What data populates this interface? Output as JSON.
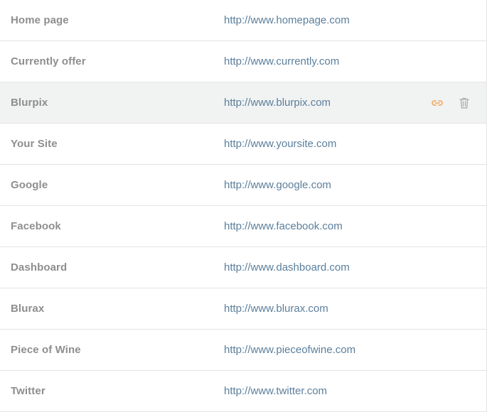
{
  "links": [
    {
      "name": "Home page",
      "url": "http://www.homepage.com"
    },
    {
      "name": "Currently offer",
      "url": "http://www.currently.com"
    },
    {
      "name": "Blurpix",
      "url": "http://www.blurpix.com",
      "highlighted": true
    },
    {
      "name": "Your Site",
      "url": "http://www.yoursite.com"
    },
    {
      "name": "Google",
      "url": "http://www.google.com"
    },
    {
      "name": "Facebook",
      "url": "http://www.facebook.com"
    },
    {
      "name": "Dashboard",
      "url": "http://www.dashboard.com"
    },
    {
      "name": "Blurax",
      "url": "http://www.blurax.com"
    },
    {
      "name": "Piece of Wine",
      "url": "http://www.pieceofwine.com"
    },
    {
      "name": "Twitter",
      "url": "http://www.twitter.com"
    }
  ],
  "row_actions": {
    "link_icon": "link-icon",
    "delete_icon": "trash-icon"
  },
  "colors": {
    "name_text": "#8e8e8e",
    "url_text": "#5b7f9c",
    "link_icon": "#f0a356",
    "trash_icon": "#a9a9a9",
    "highlight_bg": "#f1f2f2"
  }
}
